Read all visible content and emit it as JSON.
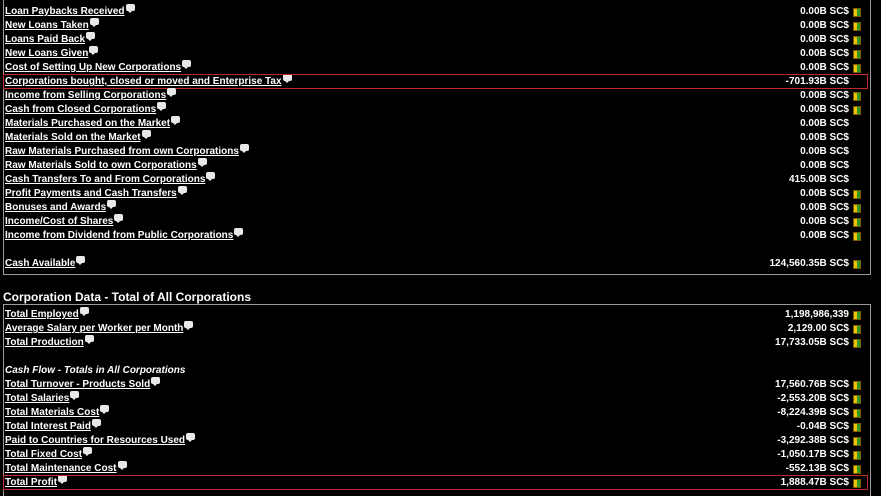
{
  "cash_flow": {
    "rows": [
      {
        "label": "Loan Paybacks Received",
        "value": "0.00B SC$",
        "chart": true
      },
      {
        "label": "New Loans Taken",
        "value": "0.00B SC$",
        "chart": true
      },
      {
        "label": "Loans Paid Back",
        "value": "0.00B SC$",
        "chart": true
      },
      {
        "label": "New Loans Given",
        "value": "0.00B SC$",
        "chart": true
      },
      {
        "label": "Cost of Setting Up New Corporations",
        "value": "0.00B SC$",
        "chart": true
      },
      {
        "label": "Corporations bought, closed or moved and Enterprise Tax",
        "value": "-701.93B SC$",
        "chart": false,
        "highlight": true
      },
      {
        "label": "Income from Selling Corporations",
        "value": "0.00B SC$",
        "chart": true
      },
      {
        "label": "Cash from Closed Corporations",
        "value": "0.00B SC$",
        "chart": true
      },
      {
        "label": "Materials Purchased on the Market",
        "value": "0.00B SC$",
        "chart": false
      },
      {
        "label": "Materials Sold on the Market",
        "value": "0.00B SC$",
        "chart": false
      },
      {
        "label": "Raw Materials Purchased from own Corporations",
        "value": "0.00B SC$",
        "chart": false
      },
      {
        "label": "Raw Materials Sold to own Corporations",
        "value": "0.00B SC$",
        "chart": false
      },
      {
        "label": "Cash Transfers To and From Corporations",
        "value": "415.00B SC$",
        "chart": false
      },
      {
        "label": "Profit Payments and Cash Transfers",
        "value": "0.00B SC$",
        "chart": true
      },
      {
        "label": "Bonuses and Awards",
        "value": "0.00B SC$",
        "chart": true
      },
      {
        "label": "Income/Cost of Shares",
        "value": "0.00B SC$",
        "chart": true
      },
      {
        "label": "Income from Dividend from Public Corporations",
        "value": "0.00B SC$",
        "chart": true
      }
    ],
    "cash_available": {
      "label": "Cash Available",
      "value": "124,560.35B SC$",
      "chart": true
    }
  },
  "corporation_data": {
    "title": "Corporation Data - Total of All Corporations",
    "summary_rows": [
      {
        "label": "Total Employed",
        "value": "1,198,986,339",
        "chart": true
      },
      {
        "label": "Average Salary per Worker per Month",
        "value": "2,129.00 SC$",
        "chart": true
      },
      {
        "label": "Total Production",
        "value": "17,733.05B SC$",
        "chart": true
      }
    ],
    "cash_flow_heading": "Cash Flow - Totals in All Corporations",
    "cash_flow_rows": [
      {
        "label": "Total Turnover - Products Sold",
        "value": "17,560.76B SC$",
        "chart": true
      },
      {
        "label": "Total Salaries",
        "value": "-2,553.20B SC$",
        "chart": true
      },
      {
        "label": "Total Materials Cost",
        "value": "-8,224.39B SC$",
        "chart": true
      },
      {
        "label": "Total Interest Paid",
        "value": "-0.04B SC$",
        "chart": true
      },
      {
        "label": "Paid to Countries for Resources Used",
        "value": "-3,292.38B SC$",
        "chart": true
      },
      {
        "label": "Total Fixed Cost",
        "value": "-1,050.17B SC$",
        "chart": true
      },
      {
        "label": "Total Maintenance Cost",
        "value": "-552.13B SC$",
        "chart": true
      },
      {
        "label": "Total Profit",
        "value": "1,888.47B SC$",
        "chart": true,
        "highlight": true
      }
    ]
  }
}
